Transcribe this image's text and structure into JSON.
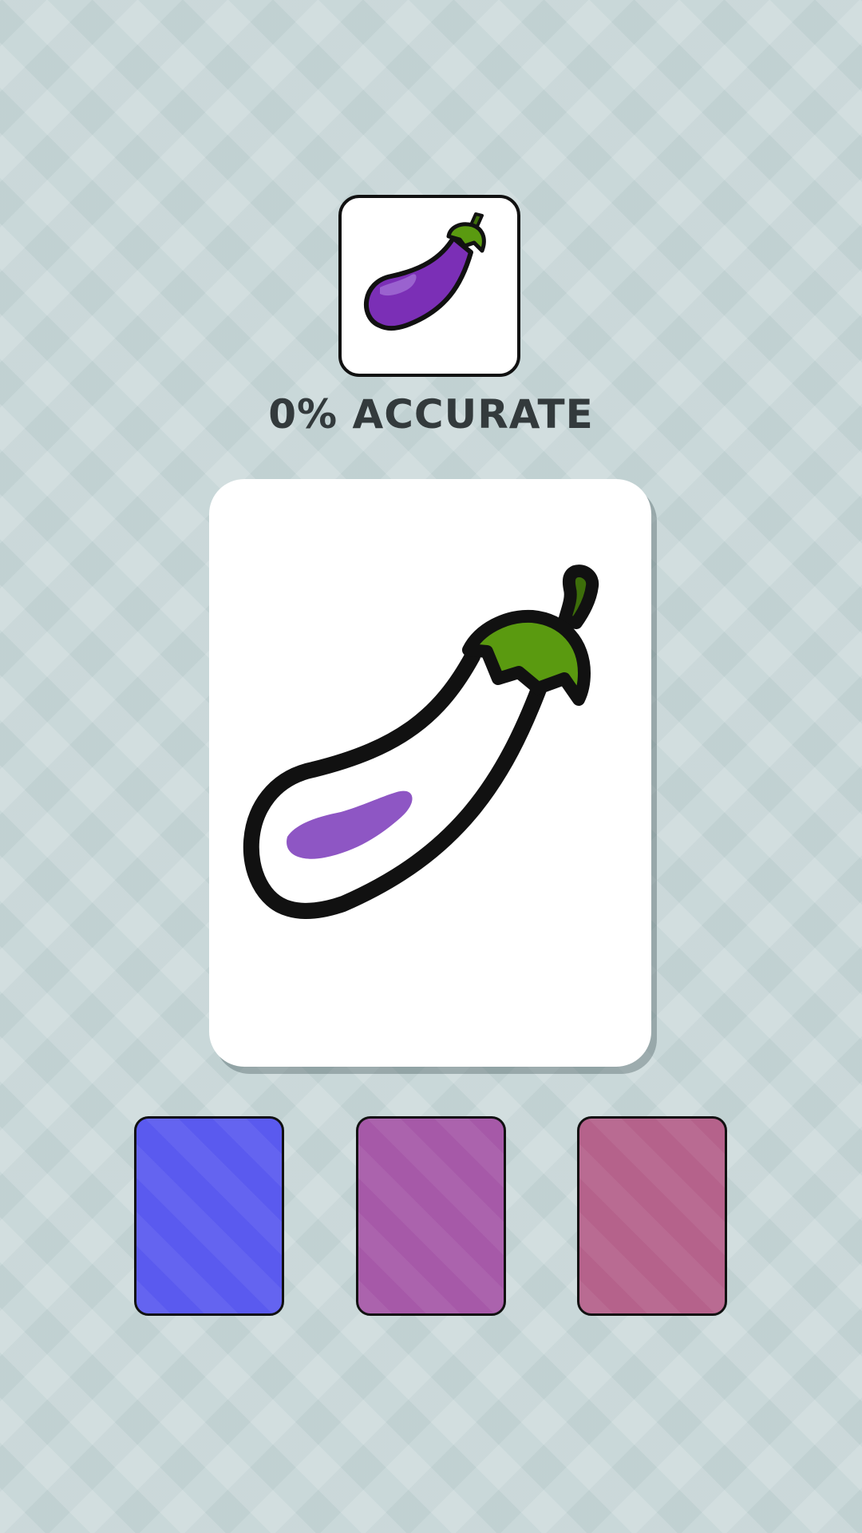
{
  "target": {
    "icon": "eggplant-icon",
    "body_color": "#7b2fb6",
    "highlight_color": "#9a62cf",
    "leaf_color": "#5a9a10",
    "outline_color": "#111111"
  },
  "accuracy_text": "0% ACCURATE",
  "accuracy": 0,
  "canvas": {
    "icon": "eggplant-outline-icon",
    "fill_color": "#ffffff",
    "highlight_color": "#8e56c4",
    "leaf_color": "#5a9a10"
  },
  "palette": {
    "swatches": [
      {
        "name": "blue",
        "color": "#5a5aef"
      },
      {
        "name": "purple",
        "color": "#a659a8"
      },
      {
        "name": "rose",
        "color": "#b5628b"
      }
    ]
  }
}
